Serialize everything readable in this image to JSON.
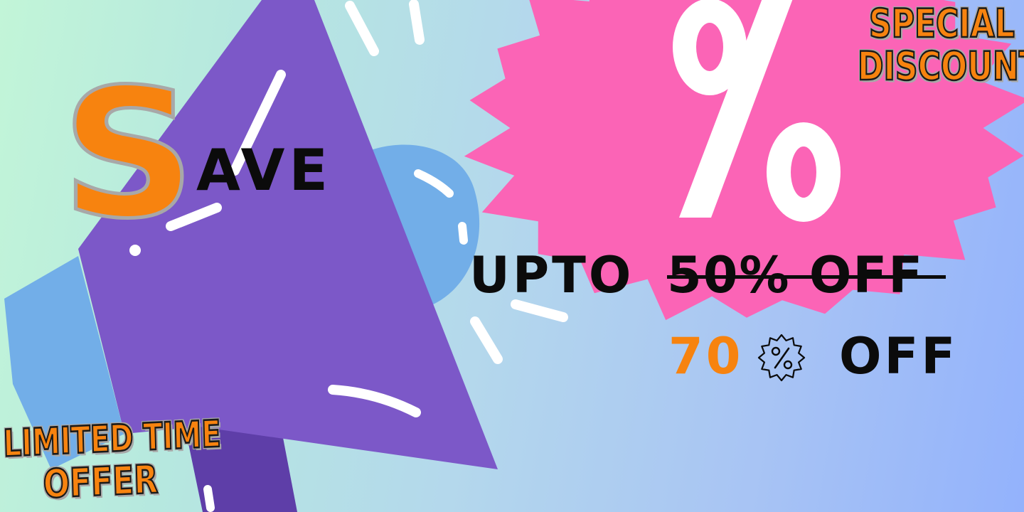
{
  "headline": {
    "save_initial": "S",
    "save_rest": "AVE"
  },
  "offer": {
    "upto_label": "UPTO",
    "old_offer": "50% OFF",
    "new_number": "70",
    "new_off_label": "OFF"
  },
  "stickers": {
    "special_line1": "SPECIAL",
    "special_line2": "DISCOUNT",
    "limited_line1": "LIMITED TIME",
    "limited_line2": "OFFER"
  },
  "icons": {
    "hero_symbol": "percent-icon",
    "megaphone": "megaphone-icon",
    "inline_badge": "percent-badge-icon"
  },
  "colors": {
    "accent_orange": "#f7830f",
    "burst_pink": "#fb64b6",
    "megaphone_purple": "#7c58c8",
    "megaphone_blue": "#72aee8",
    "text_black": "#0b0b0b"
  }
}
